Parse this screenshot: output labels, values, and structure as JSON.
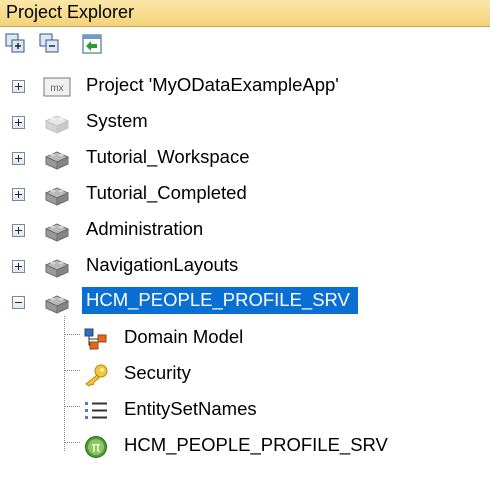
{
  "panel": {
    "title": "Project Explorer"
  },
  "toolbar": {
    "buttons": [
      {
        "icon": "expand-all-icon"
      },
      {
        "icon": "collapse-all-icon"
      },
      {
        "icon": "link-with-editor-icon"
      }
    ]
  },
  "tree": {
    "items": [
      {
        "label": "Project 'MyODataExampleApp'",
        "icon": "project-icon",
        "icon_text": "mx",
        "expanded": false
      },
      {
        "label": "System",
        "icon": "module-icon-gray",
        "expanded": false
      },
      {
        "label": "Tutorial_Workspace",
        "icon": "module-icon",
        "expanded": false
      },
      {
        "label": "Tutorial_Completed",
        "icon": "module-icon",
        "expanded": false
      },
      {
        "label": "Administration",
        "icon": "module-icon",
        "expanded": false
      },
      {
        "label": "NavigationLayouts",
        "icon": "module-icon",
        "expanded": false
      },
      {
        "label": "HCM_PEOPLE_PROFILE_SRV",
        "icon": "module-icon",
        "expanded": true,
        "selected": true
      }
    ],
    "children": [
      {
        "label": "Domain Model",
        "icon": "domain-model-icon"
      },
      {
        "label": "Security",
        "icon": "security-key-icon"
      },
      {
        "label": "EntitySetNames",
        "icon": "enumeration-list-icon"
      },
      {
        "label": "HCM_PEOPLE_PROFILE_SRV",
        "icon": "constant-pi-icon"
      }
    ]
  },
  "colors": {
    "selection": "#0a6fd3",
    "title_bar": "#f4d27a"
  }
}
